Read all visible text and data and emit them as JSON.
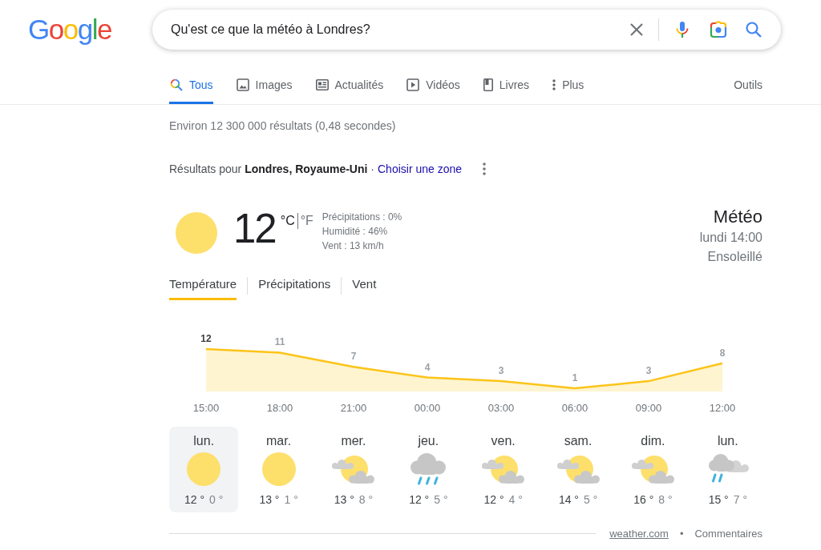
{
  "logo": "Google",
  "search": {
    "value": "Qu'est ce que la météo à Londres?"
  },
  "tabs": [
    {
      "label": "Tous",
      "kind": "search",
      "selected": true
    },
    {
      "label": "Images",
      "kind": "image",
      "selected": false
    },
    {
      "label": "Actualités",
      "kind": "news",
      "selected": false
    },
    {
      "label": "Vidéos",
      "kind": "video",
      "selected": false
    },
    {
      "label": "Livres",
      "kind": "book",
      "selected": false
    },
    {
      "label": "Plus",
      "kind": "more",
      "selected": false
    }
  ],
  "tools": "Outils",
  "result_stats": "Environ 12 300 000 résultats (0,48 secondes)",
  "location": {
    "text": "Résultats pour **Londres, Royaume-Uni** ·",
    "link": "Choisir une zone"
  },
  "weather": {
    "current": {
      "kind": "sunny",
      "temperature": "12",
      "units": [
        {
          "label": "°C",
          "selected": true
        },
        {
          "label": "°F",
          "selected": false
        }
      ],
      "details": [
        "Précipitations : 0%",
        "Humidité : 46%",
        "Vent : 13 km/h"
      ]
    },
    "title": "Météo",
    "time": "lundi 14:00",
    "condition": "Ensoleillé",
    "tabs": [
      {
        "label": "Température",
        "selected": true
      },
      {
        "label": "Précipitations",
        "selected": false
      },
      {
        "label": "Vent",
        "selected": false
      }
    ],
    "chart": {
      "points": [
        {
          "selected": true
        },
        {
          "selected": false
        },
        {
          "selected": false
        },
        {
          "selected": false
        },
        {
          "selected": false
        },
        {
          "selected": false
        },
        {
          "selected": false
        },
        {
          "selected": false
        }
      ],
      "chart_data": {
        "type": "area",
        "categories": [
          "15:00",
          "18:00",
          "21:00",
          "00:00",
          "03:00",
          "06:00",
          "09:00",
          "12:00"
        ],
        "values": [
          12,
          11,
          7,
          4,
          3,
          1,
          3,
          8
        ],
        "data_labels": true
      }
    },
    "days": [
      {
        "name": "lun.",
        "kind": "sunny",
        "high": "12 °",
        "low": "0 °",
        "selected": true
      },
      {
        "name": "mar.",
        "kind": "sunny",
        "high": "13 °",
        "low": "1 °",
        "selected": false
      },
      {
        "name": "mer.",
        "kind": "partly_cloudy",
        "high": "13 °",
        "low": "8 °",
        "selected": false
      },
      {
        "name": "jeu.",
        "kind": "rain",
        "high": "12 °",
        "low": "5 °",
        "selected": false
      },
      {
        "name": "ven.",
        "kind": "partly_cloudy",
        "high": "12 °",
        "low": "4 °",
        "selected": false
      },
      {
        "name": "sam.",
        "kind": "partly_cloudy",
        "high": "14 °",
        "low": "5 °",
        "selected": false
      },
      {
        "name": "dim.",
        "kind": "partly_cloudy",
        "high": "16 °",
        "low": "8 °",
        "selected": false
      },
      {
        "name": "lun.",
        "kind": "showers",
        "high": "15 °",
        "low": "7 °",
        "selected": false
      }
    ],
    "source": "weather.com",
    "separator": "•",
    "feedback": "Commentaires"
  }
}
